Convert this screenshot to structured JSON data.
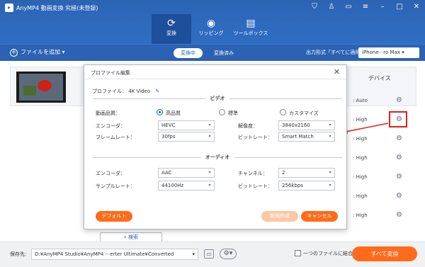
{
  "app": {
    "title": "AnyMP4 動画変換 究極(未登録)"
  },
  "nav": {
    "tabs": [
      {
        "label": "変換",
        "icon": "convert-icon"
      },
      {
        "label": "リッピング",
        "icon": "disc-icon"
      },
      {
        "label": "ツールボックス",
        "icon": "toolbox-icon"
      }
    ]
  },
  "toolbar": {
    "add_label": "ファイルを追加",
    "seg_converting": "変換中",
    "seg_converted": "変換済み",
    "output_format_label": "出力形式「すべてに適用」:",
    "output_format_value": "iPhone···ro Max"
  },
  "right_panel": {
    "header": "デバイス",
    "rows": [
      ": Auto",
      ": High",
      ": High",
      ": High",
      ": High",
      ": High",
      ": High",
      ": High"
    ]
  },
  "bottom": {
    "save_label": "保存先:",
    "save_path": "D:¥AnyMP4 Studio¥AnyMP4 ···erter Ultimate¥Converted",
    "merge_label": "一つのファイルに結合",
    "convert_all": "すべて変換",
    "search_label": "検索"
  },
  "dialog": {
    "title": "プロファイル編集",
    "profile_label": "プロファイル：",
    "profile_value": "4K Video",
    "video_section": "ビデオ",
    "audio_section": "オーディオ",
    "quality_label": "動画品質：",
    "quality_options": [
      "高品質",
      "標準",
      "カスタマイズ"
    ],
    "video_encoder_label": "エンコーダ：",
    "video_encoder_value": "HEVC",
    "resolution_label": "解像度：",
    "resolution_value": "3840x2160",
    "framerate_label": "フレームレート：",
    "framerate_value": "30fps",
    "video_bitrate_label": "ビットレート：",
    "video_bitrate_value": "Smart Match",
    "audio_encoder_label": "エンコーダ：",
    "audio_encoder_value": "AAC",
    "channel_label": "チャンネル：",
    "channel_value": "2",
    "samplerate_label": "サンプルレート：",
    "samplerate_value": "44100Hz",
    "audio_bitrate_label": "ビットレート：",
    "audio_bitrate_value": "256kbps",
    "btn_default": "デフォルト",
    "btn_new": "新規作成",
    "btn_cancel": "キャンセル"
  },
  "colors": {
    "brand": "#2f6ec4",
    "accent": "#ff6b1a",
    "highlight": "#e02020"
  }
}
